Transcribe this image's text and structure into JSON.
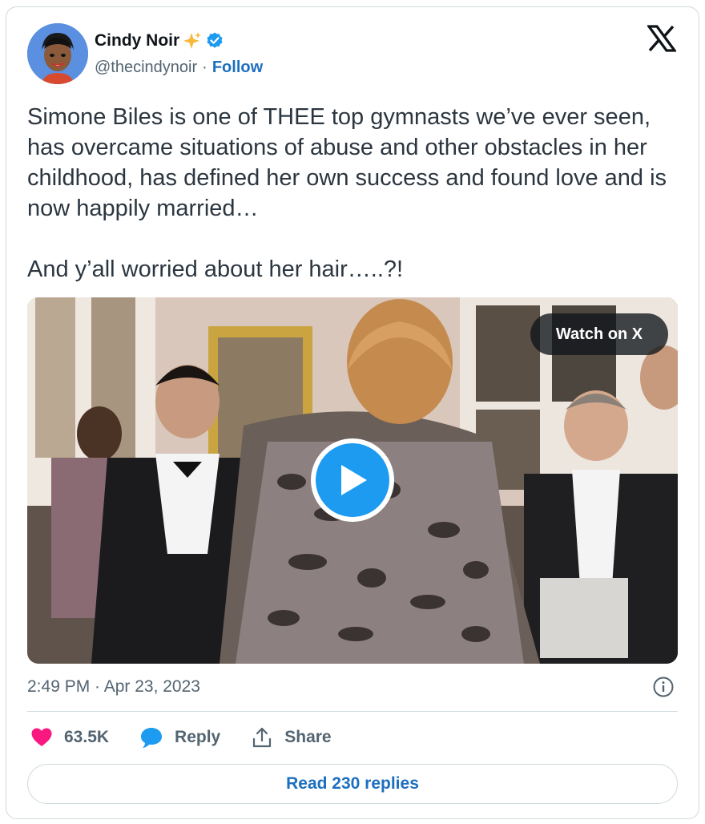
{
  "author": {
    "display_name": "Cindy Noir",
    "handle": "@thecindynoir",
    "separator": "·",
    "follow_label": "Follow"
  },
  "tweet": {
    "text": "Simone Biles is one of THEE top gymnasts we’ve ever seen, has overcame situations of abuse and other obstacles in her childhood, has defined her own success and found love and is now happily married…\n\nAnd y’all worried about her hair…..?!"
  },
  "media": {
    "watch_label": "Watch on X"
  },
  "meta": {
    "timestamp": "2:49 PM · Apr 23, 2023"
  },
  "actions": {
    "like_count": "63.5K",
    "reply_label": "Reply",
    "share_label": "Share"
  },
  "footer": {
    "read_replies_label": "Read 230 replies"
  },
  "colors": {
    "brand_blue": "#1d9bf0",
    "link_blue": "#1d6fbf",
    "heart_pink": "#f91880",
    "muted_text": "#536471",
    "border": "#cfd9de"
  },
  "icons": [
    "x-logo-icon",
    "sparkles-icon",
    "verified-badge-icon",
    "play-icon",
    "info-icon",
    "heart-icon",
    "reply-bubble-icon",
    "share-icon"
  ]
}
